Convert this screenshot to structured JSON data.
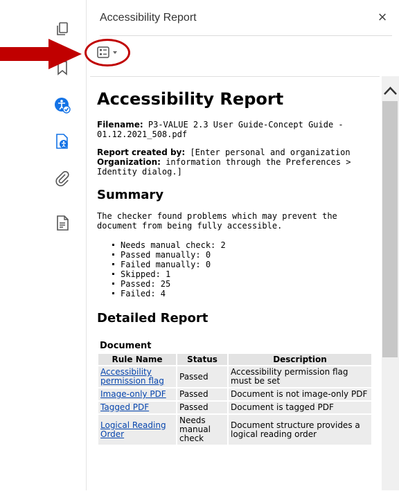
{
  "panel": {
    "title": "Accessibility Report",
    "close_glyph": "×"
  },
  "left_rail": {
    "icons": [
      "pages-icon",
      "bookmark-icon",
      "accessibility-check-icon",
      "accessibility-report-icon",
      "attachment-icon",
      "document-icon"
    ]
  },
  "annotation": {
    "arrow_color": "#c00000",
    "ring_color": "#c00000"
  },
  "report": {
    "title": "Accessibility Report",
    "filename_label": "Filename:",
    "filename_value": " P3-VALUE 2.3 User Guide-Concept Guide - 01.12.2021_508.pdf",
    "created_by_label": "Report created by:",
    "created_by_value": " [Enter personal and organization",
    "organization_label": "Organization:",
    "organization_value": " information through the Preferences > Identity dialog.]",
    "summary_heading": "Summary",
    "summary_text": "The checker found problems which may prevent the document from being fully accessible.",
    "summary_items": [
      "Needs manual check: 2",
      "Passed manually: 0",
      "Failed manually: 0",
      "Skipped: 1",
      "Passed: 25",
      "Failed: 4"
    ],
    "detailed_heading": "Detailed Report",
    "document_heading": "Document",
    "table": {
      "headers": [
        "Rule Name",
        "Status",
        "Description"
      ],
      "rows": [
        {
          "rule": "Accessibility permission flag",
          "status": "Passed",
          "description": "Accessibility permission flag must be set"
        },
        {
          "rule": "Image-only PDF",
          "status": "Passed",
          "description": "Document is not image-only PDF"
        },
        {
          "rule": "Tagged PDF",
          "status": "Passed",
          "description": "Document is tagged PDF"
        },
        {
          "rule": "Logical Reading Order",
          "status": "Needs manual check",
          "description": "Document structure provides a logical reading order"
        }
      ]
    }
  },
  "colors": {
    "icon_gray": "#555555",
    "icon_blue": "#1473e6",
    "link": "#0645ad"
  }
}
